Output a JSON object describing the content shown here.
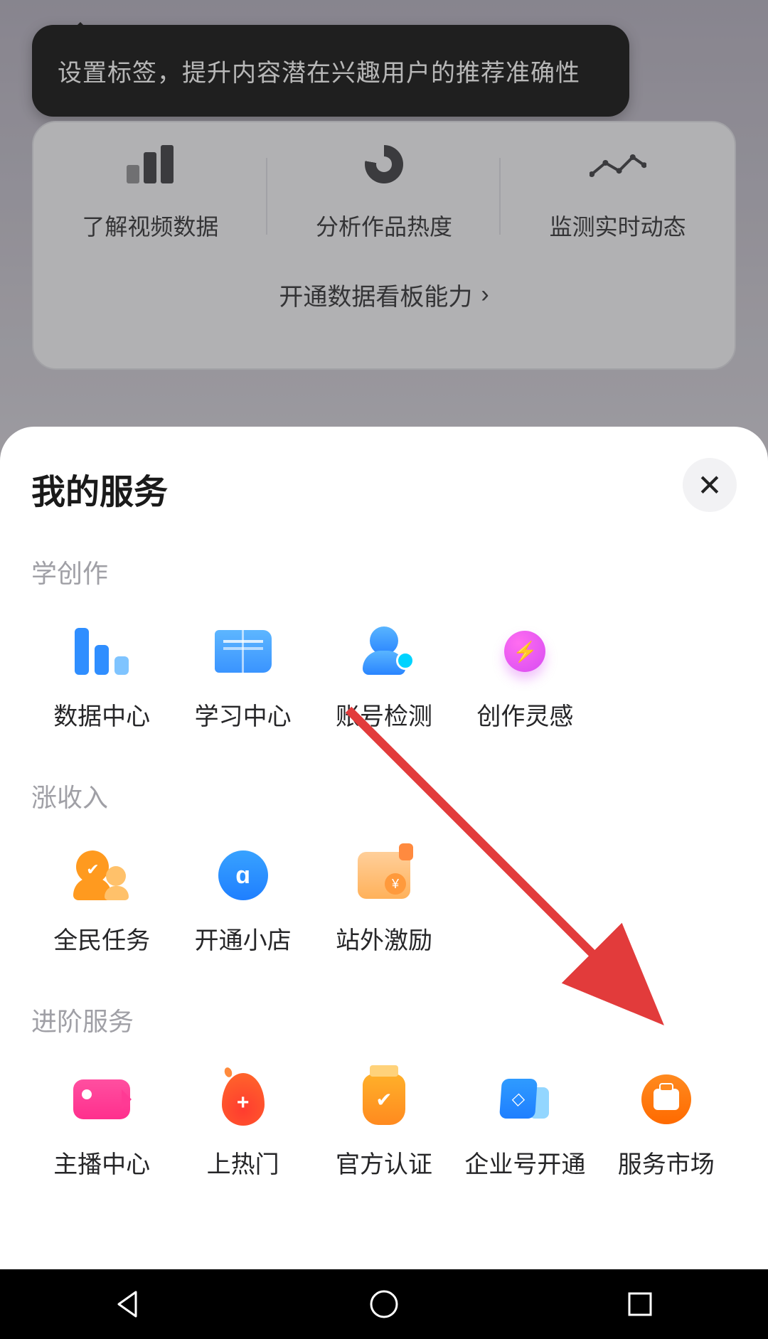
{
  "tooltip": "设置标签，提升内容潜在兴趣用户的推荐准确性",
  "dashboard": {
    "items": [
      "了解视频数据",
      "分析作品热度",
      "监测实时动态"
    ],
    "link": "开通数据看板能力"
  },
  "sheet": {
    "title": "我的服务",
    "sections": [
      {
        "title": "学创作",
        "items": [
          {
            "label": "数据中心",
            "icon": "bars"
          },
          {
            "label": "学习中心",
            "icon": "book"
          },
          {
            "label": "账号检测",
            "icon": "acct"
          },
          {
            "label": "创作灵感",
            "icon": "bulb"
          }
        ]
      },
      {
        "title": "涨收入",
        "items": [
          {
            "label": "全民任务",
            "icon": "people"
          },
          {
            "label": "开通小店",
            "icon": "shop"
          },
          {
            "label": "站外激励",
            "icon": "bag"
          }
        ]
      },
      {
        "title": "进阶服务",
        "items": [
          {
            "label": "主播中心",
            "icon": "cam"
          },
          {
            "label": "上热门",
            "icon": "fire"
          },
          {
            "label": "官方认证",
            "icon": "badge"
          },
          {
            "label": "企业号开通",
            "icon": "ent"
          },
          {
            "label": "服务市场",
            "icon": "mkt"
          }
        ]
      }
    ]
  }
}
